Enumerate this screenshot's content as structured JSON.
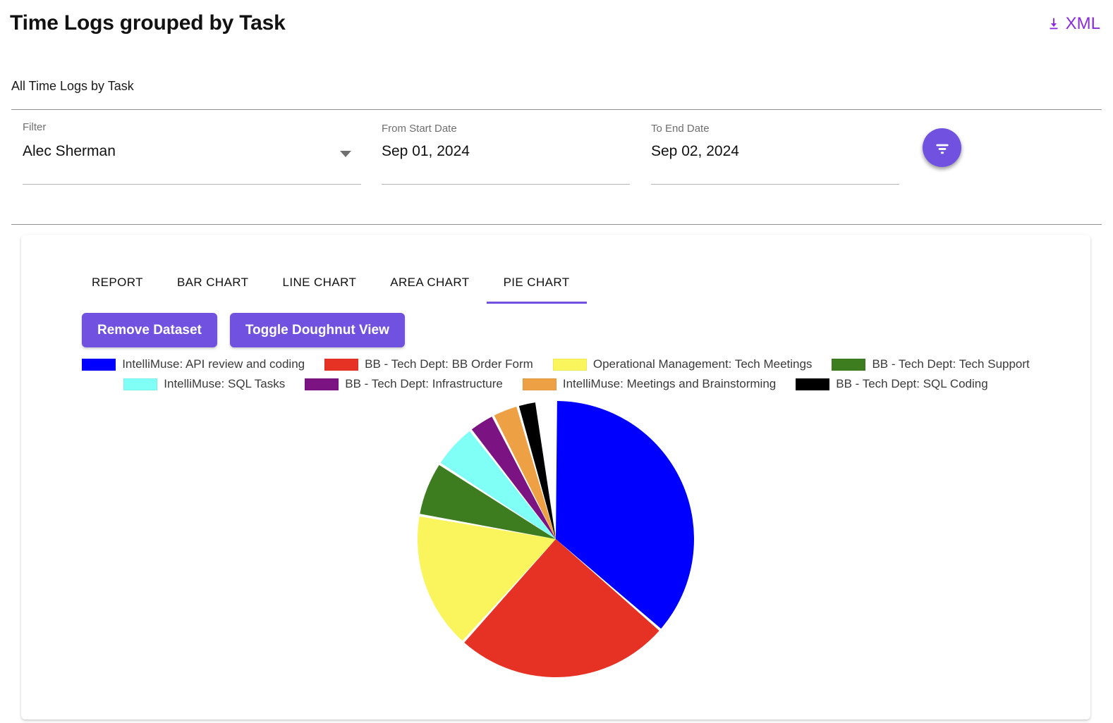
{
  "header": {
    "title": "Time Logs grouped by Task",
    "export_label": "XML",
    "export_icon": "download-icon"
  },
  "subtitle": "All Time Logs by Task",
  "filters": {
    "filter": {
      "label": "Filter",
      "value": "Alec Sherman",
      "caret_icon": "chevron-down-icon"
    },
    "from_date": {
      "label": "From Start Date",
      "value": "Sep 01, 2024"
    },
    "to_date": {
      "label": "To End Date",
      "value": "Sep 02, 2024"
    },
    "apply_button": {
      "icon": "filter-icon",
      "color": "#7152E0"
    }
  },
  "tabs": [
    {
      "label": "REPORT",
      "active": false
    },
    {
      "label": "BAR CHART",
      "active": false
    },
    {
      "label": "LINE CHART",
      "active": false
    },
    {
      "label": "AREA CHART",
      "active": false
    },
    {
      "label": "PIE CHART",
      "active": true
    }
  ],
  "actions": {
    "remove_dataset": "Remove Dataset",
    "toggle_doughnut": "Toggle Doughnut View"
  },
  "theme": {
    "accent": "#7152E0",
    "export_link": "#8A2BE2"
  },
  "chart_data": {
    "type": "pie",
    "title": "All Time Logs by Task",
    "legend_position": "top",
    "legend_rows": [
      4,
      4
    ],
    "labels": [
      "IntelliMuse: API review and coding",
      "BB - Tech Dept: BB Order Form",
      "Operational Management: Tech Meetings",
      "BB - Tech Dept: Tech Support",
      "IntelliMuse: SQL Tasks",
      "BB - Tech Dept: Infrastructure",
      "IntelliMuse: Meetings and Brainstorming",
      "BB - Tech Dept: SQL Coding"
    ],
    "colors": [
      "#0000FF",
      "#E63125",
      "#FAF55C",
      "#3D7C1F",
      "#7FFFF6",
      "#7B1382",
      "#EDA044",
      "#000000"
    ],
    "values": [
      36.4,
      25.3,
      16.1,
      6.4,
      5.3,
      3.1,
      3.1,
      2.2
    ],
    "units": "percent",
    "start_angle_deg": 0,
    "slices": [
      {
        "label": "IntelliMuse: API review and coding",
        "color": "#0000FF",
        "value": 36.4,
        "start_deg": 0,
        "end_deg": 131
      },
      {
        "label": "BB - Tech Dept: BB Order Form",
        "color": "#E63125",
        "value": 25.3,
        "start_deg": 131,
        "end_deg": 222
      },
      {
        "label": "Operational Management: Tech Meetings",
        "color": "#FAF55C",
        "value": 16.1,
        "start_deg": 222,
        "end_deg": 280
      },
      {
        "label": "BB - Tech Dept: Tech Support",
        "color": "#3D7C1F",
        "value": 6.4,
        "start_deg": 280,
        "end_deg": 303
      },
      {
        "label": "IntelliMuse: SQL Tasks",
        "color": "#7FFFF6",
        "value": 5.3,
        "start_deg": 303,
        "end_deg": 322
      },
      {
        "label": "BB - Tech Dept: Infrastructure",
        "color": "#7B1382",
        "value": 3.1,
        "start_deg": 322,
        "end_deg": 333
      },
      {
        "label": "IntelliMuse: Meetings and Brainstorming",
        "color": "#EDA044",
        "value": 3.1,
        "start_deg": 333,
        "end_deg": 344
      },
      {
        "label": "BB - Tech Dept: SQL Coding",
        "color": "#000000",
        "value": 2.2,
        "start_deg": 344,
        "end_deg": 352
      }
    ]
  }
}
